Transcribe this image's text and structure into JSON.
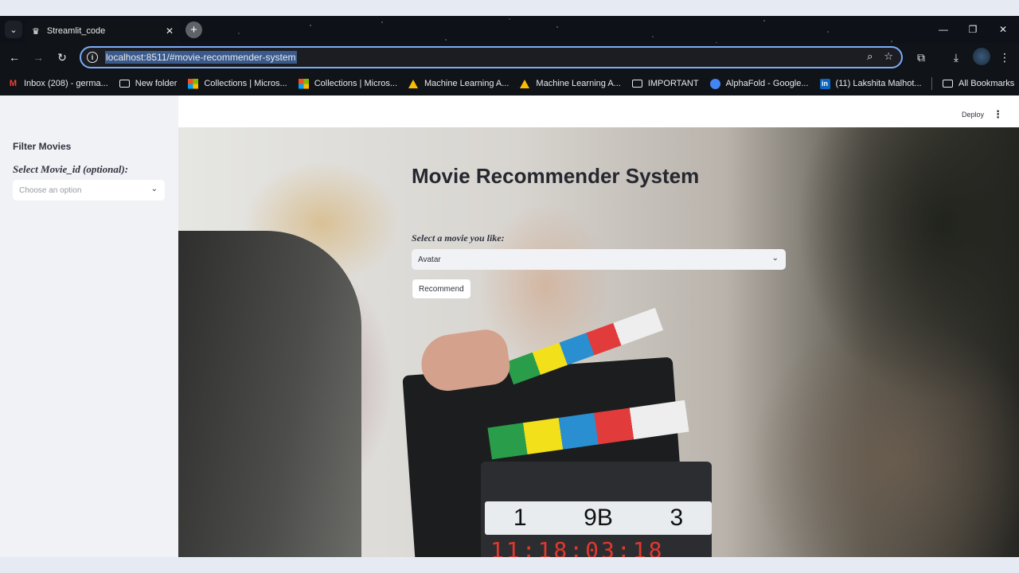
{
  "browser": {
    "tab_title": "Streamlit_code",
    "new_tab": "+",
    "url": "localhost:8511/#movie-recommender-system",
    "bookmarks": [
      {
        "label": "Inbox (208) - germa...",
        "icon": "gmail-icon"
      },
      {
        "label": "New folder",
        "icon": "folder-icon"
      },
      {
        "label": "Collections | Micros...",
        "icon": "microsoft-icon"
      },
      {
        "label": "Collections | Micros...",
        "icon": "microsoft-icon"
      },
      {
        "label": "Machine Learning A...",
        "icon": "drive-icon"
      },
      {
        "label": "Machine Learning A...",
        "icon": "drive-icon"
      },
      {
        "label": "IMPORTANT",
        "icon": "folder-icon"
      },
      {
        "label": "AlphaFold - Google...",
        "icon": "alphafold-icon"
      },
      {
        "label": "(11) Lakshita Malhot...",
        "icon": "linkedin-icon"
      }
    ],
    "all_bookmarks": "All Bookmarks"
  },
  "app": {
    "deploy_label": "Deploy",
    "sidebar": {
      "heading": "Filter Movies",
      "select_label": "Select Movie_id (optional):",
      "select_placeholder": "Choose an option"
    },
    "main": {
      "title": "Movie Recommender System",
      "select_label": "Select a movie you like:",
      "select_value": "Avatar",
      "button_label": "Recommend"
    },
    "background": {
      "slate_values": [
        "1",
        "9B",
        "3"
      ],
      "timecode": "11:18:03:18"
    }
  }
}
